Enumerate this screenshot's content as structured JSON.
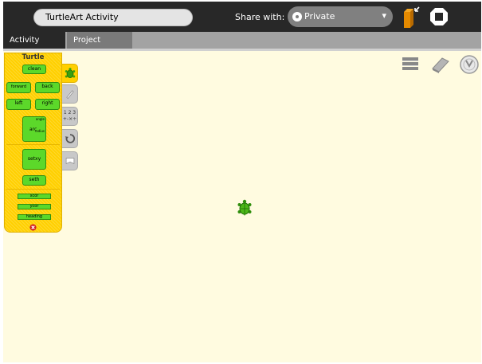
{
  "toolbar": {
    "activity_title": "TurtleArt Activity",
    "share_label": "Share with:",
    "share_value": "Private",
    "keep_icon": "keep-icon",
    "stop_icon": "stop-icon"
  },
  "tabs": [
    {
      "label": "Activity",
      "active": true
    },
    {
      "label": "Project",
      "active": false
    }
  ],
  "palette": {
    "title": "Turtle",
    "blocks": {
      "clean": "clean",
      "forward": "forward",
      "back": "back",
      "left": "left",
      "right": "right",
      "arc": "arc",
      "arc_angle": "angle",
      "arc_radius": "radius",
      "setxy": "setxy",
      "seth": "seth",
      "xcor": "xcor",
      "ycor": "ycor",
      "heading": "heading"
    },
    "tabs": [
      "turtle-icon",
      "pen-icon",
      "numbers-icon",
      "flow-icon",
      "blocks-icon"
    ],
    "numbers_tab_text": "1 2 3\n+-×÷"
  },
  "tools": [
    "stack-icon",
    "eraser-icon",
    "run-icon"
  ],
  "colors": {
    "toolbar_bg": "#282828",
    "canvas_bg": "#fffbe0",
    "palette_bg": "#ffd000",
    "block_green": "#5cd82a"
  }
}
